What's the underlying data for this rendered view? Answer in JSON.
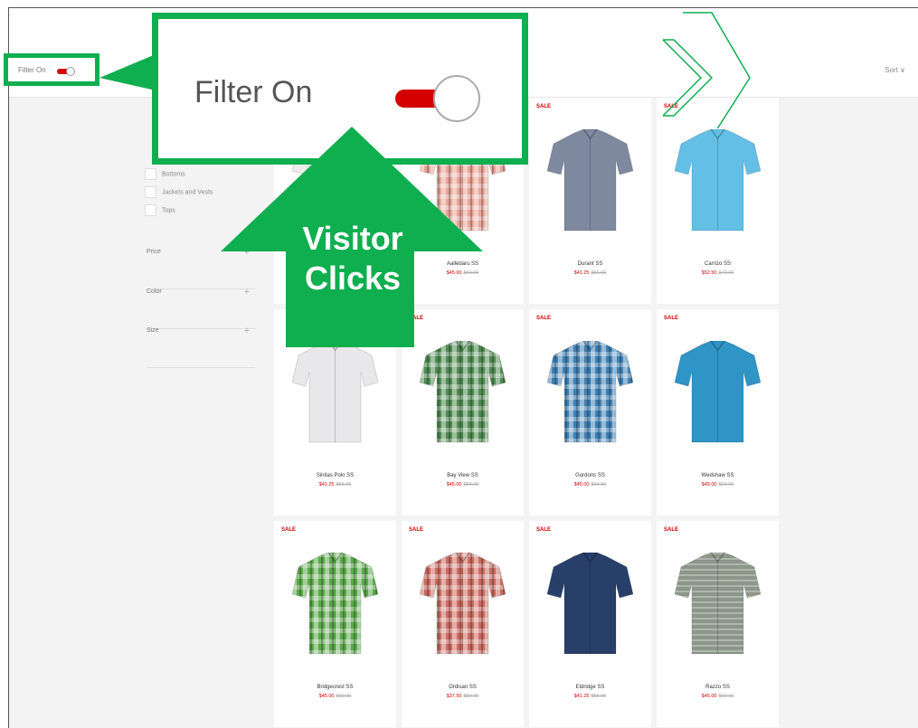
{
  "filter_control": {
    "label": "Filter On",
    "state": "on",
    "toggle_color": "#d40000"
  },
  "callout": {
    "label": "Filter On"
  },
  "annotation": {
    "line1": "Visitor",
    "line2": "Clicks",
    "color": "#0fae4f"
  },
  "sort": {
    "label": "Sort ∨"
  },
  "categories": [
    {
      "label": "Bottoms"
    },
    {
      "label": "Jackets and Vests"
    },
    {
      "label": "Tops"
    }
  ],
  "facets": [
    {
      "label": "Price"
    },
    {
      "label": "Color"
    },
    {
      "label": "Size"
    }
  ],
  "products": [
    {
      "name": "",
      "price": "",
      "was": "",
      "sale": "",
      "color": "#ededed",
      "pattern": "solid"
    },
    {
      "name": "Aallebaru SS",
      "price": "$45.00",
      "was": "$60.00",
      "sale": "",
      "color": "#e7a598",
      "pattern": "plaid"
    },
    {
      "name": "Durant SS",
      "price": "$41.25",
      "was": "$55.00",
      "sale": "SALE",
      "color": "#7e889e",
      "pattern": "solid"
    },
    {
      "name": "Carrizo SS",
      "price": "$52.50",
      "was": "$70.00",
      "sale": "SALE",
      "color": "#63bfe5",
      "pattern": "solid"
    },
    {
      "name": "Sinitas Polo SS",
      "price": "$41.25",
      "was": "$55.00",
      "sale": "",
      "color": "#e8e8ea",
      "pattern": "solid"
    },
    {
      "name": "Bay View SS",
      "price": "$45.00",
      "was": "$60.00",
      "sale": "SALE",
      "color": "#4f8a52",
      "pattern": "plaid"
    },
    {
      "name": "Gordons SS",
      "price": "$45.00",
      "was": "$60.00",
      "sale": "SALE",
      "color": "#3f7fb3",
      "pattern": "plaid"
    },
    {
      "name": "Wedshaw SS",
      "price": "$45.00",
      "was": "$60.00",
      "sale": "SALE",
      "color": "#2f94c6",
      "pattern": "solid"
    },
    {
      "name": "Bridgecrest SS",
      "price": "$45.00",
      "was": "$60.00",
      "sale": "SALE",
      "color": "#5aa84a",
      "pattern": "plaid"
    },
    {
      "name": "Ordisan SS",
      "price": "$37.50",
      "was": "$50.00",
      "sale": "SALE",
      "color": "#c96b61",
      "pattern": "plaid"
    },
    {
      "name": "Eldridge SS",
      "price": "$41.25",
      "was": "$55.00",
      "sale": "SALE",
      "color": "#283f6a",
      "pattern": "solid"
    },
    {
      "name": "Razzo SS",
      "price": "$45.00",
      "was": "$60.00",
      "sale": "SALE",
      "color": "#8c978a",
      "pattern": "stripe"
    }
  ]
}
